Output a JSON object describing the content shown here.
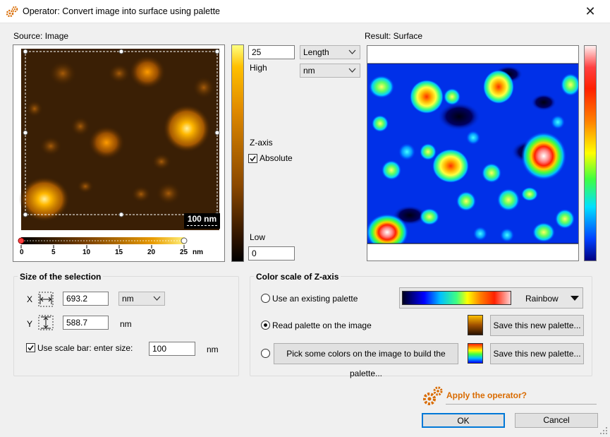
{
  "window": {
    "title": "Operator: Convert image into surface using palette"
  },
  "source": {
    "label": "Source: Image",
    "scale_bar_text": "100 nm",
    "ruler_ticks": [
      "0",
      "5",
      "10",
      "15",
      "20",
      "25"
    ],
    "ruler_unit": "nm"
  },
  "zaxis": {
    "high_value": "25",
    "high_label": "High",
    "dimension_select": "Length",
    "unit_select": "nm",
    "zaxis_label": "Z-axis",
    "absolute_label": "Absolute",
    "absolute_checked": true,
    "low_label": "Low",
    "low_value": "0"
  },
  "result": {
    "label": "Result: Surface"
  },
  "selection": {
    "title": "Size of the selection",
    "x_label": "X",
    "x_value": "693.2",
    "x_unit_select": "nm",
    "y_label": "Y",
    "y_value": "588.7",
    "y_unit": "nm",
    "scalebar_label": "Use scale bar: enter size:",
    "scalebar_checked": true,
    "scalebar_value": "100",
    "scalebar_unit": "nm"
  },
  "colorscale": {
    "title": "Color scale of Z-axis",
    "opt_existing": "Use an existing palette",
    "palette_name": "Rainbow",
    "opt_read": "Read palette on the image",
    "opt_read_selected": true,
    "opt_pick": "Pick some colors on the image to build the palette...",
    "save1": "Save this new palette...",
    "save2": "Save this new palette..."
  },
  "footer": {
    "apply_label": "Apply the operator?",
    "ok_label": "OK",
    "cancel_label": "Cancel"
  },
  "colors": {
    "accent_orange": "#d96b00",
    "ok_border": "#0078d7"
  }
}
